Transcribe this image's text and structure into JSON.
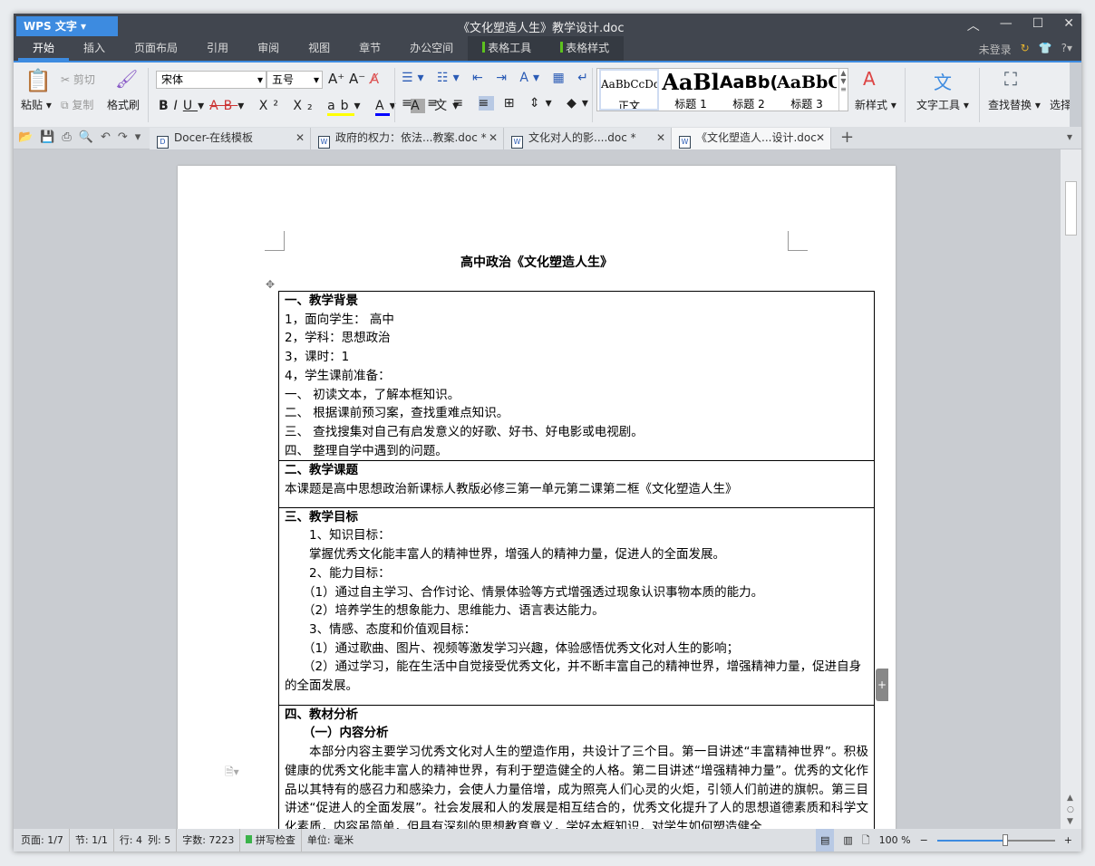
{
  "app": {
    "name": "WPS 文字",
    "doc_title": "《文化塑造人生》教学设计.doc"
  },
  "menu": {
    "items": [
      "开始",
      "插入",
      "页面布局",
      "引用",
      "审阅",
      "视图",
      "章节",
      "办公空间"
    ],
    "tools": [
      "表格工具",
      "表格样式"
    ],
    "login": "未登录"
  },
  "ribbon": {
    "paste": "粘贴",
    "cut": "剪切",
    "copy": "复制",
    "format_painter": "格式刷",
    "font": "宋体",
    "size": "五号",
    "styles": [
      {
        "sample": "AaBbCcDd",
        "label": "正文"
      },
      {
        "sample": "AaBl",
        "label": "标题 1"
      },
      {
        "sample": "AaBb(",
        "label": "标题 2"
      },
      {
        "sample": "AaBbC",
        "label": "标题 3"
      }
    ],
    "new_style": "新样式",
    "text_tools": "文字工具",
    "find_replace": "查找替换",
    "select": "选择"
  },
  "tabs": [
    {
      "label": "Docer-在线模板"
    },
    {
      "label": "政府的权力：依法...教案.doc *"
    },
    {
      "label": "文化对人的影....doc *"
    },
    {
      "label": "《文化塑造人...设计.doc"
    }
  ],
  "document": {
    "title": "高中政治《文化塑造人生》",
    "sections": [
      {
        "heading": "一、教学背景",
        "lines": [
          "1，面向学生： 高中",
          "2，学科：思想政治",
          "3，课时：1",
          "4，学生课前准备：",
          "一、 初读文本，了解本框知识。",
          "二、 根据课前预习案，查找重难点知识。",
          "三、 查找搜集对自己有启发意义的好歌、好书、好电影或电视剧。",
          "四、 整理自学中遇到的问题。"
        ]
      },
      {
        "heading": "二、教学课题",
        "lines": [
          "本课题是高中思想政治新课标人教版必修三第一单元第二课第二框《文化塑造人生》"
        ]
      },
      {
        "heading": "三、教学目标",
        "lines": [
          "1、知识目标：",
          "掌握优秀文化能丰富人的精神世界，增强人的精神力量，促进人的全面发展。",
          "2、能力目标：",
          "（1）通过自主学习、合作讨论、情景体验等方式增强透过现象认识事物本质的能力。",
          "（2）培养学生的想象能力、思维能力、语言表达能力。",
          "3、情感、态度和价值观目标：",
          "（1）通过歌曲、图片、视频等激发学习兴趣，体验感悟优秀文化对人生的影响；",
          "（2）通过学习，能在生活中自觉接受优秀文化，并不断丰富自己的精神世界，增强精神力量，促进自身的全面发展。"
        ]
      },
      {
        "heading": "四、教材分析",
        "subheading": "（一）内容分析",
        "paragraph": "本部分内容主要学习优秀文化对人生的塑造作用，共设计了三个目。第一目讲述“丰富精神世界”。积极健康的优秀文化能丰富人的精神世界，有利于塑造健全的人格。第二目讲述“增强精神力量”。优秀的文化作品以其特有的感召力和感染力，会使人力量倍增，成为照亮人们心灵的火炬，引领人们前进的旗帜。第三目讲述“促进人的全面发展”。社会发展和人的发展是相互结合的，优秀文化提升了人的思想道德素质和科学文化素质，内容虽简单，但具有深刻的思想教育意义，学好本框知识，对学生如何塑造健全"
      }
    ]
  },
  "status": {
    "page": "页面: 1/7",
    "section": "节: 1/1",
    "row": "行: 4",
    "col": "列: 5",
    "words": "字数: 7223",
    "spell": "拼写检查",
    "unit": "单位: 毫米",
    "zoom": "100 %",
    "zoom_percent": 100
  },
  "colors": {
    "accent": "#3d8be0",
    "titlebar": "#41464f",
    "tool_marker": "#5dc21e"
  }
}
